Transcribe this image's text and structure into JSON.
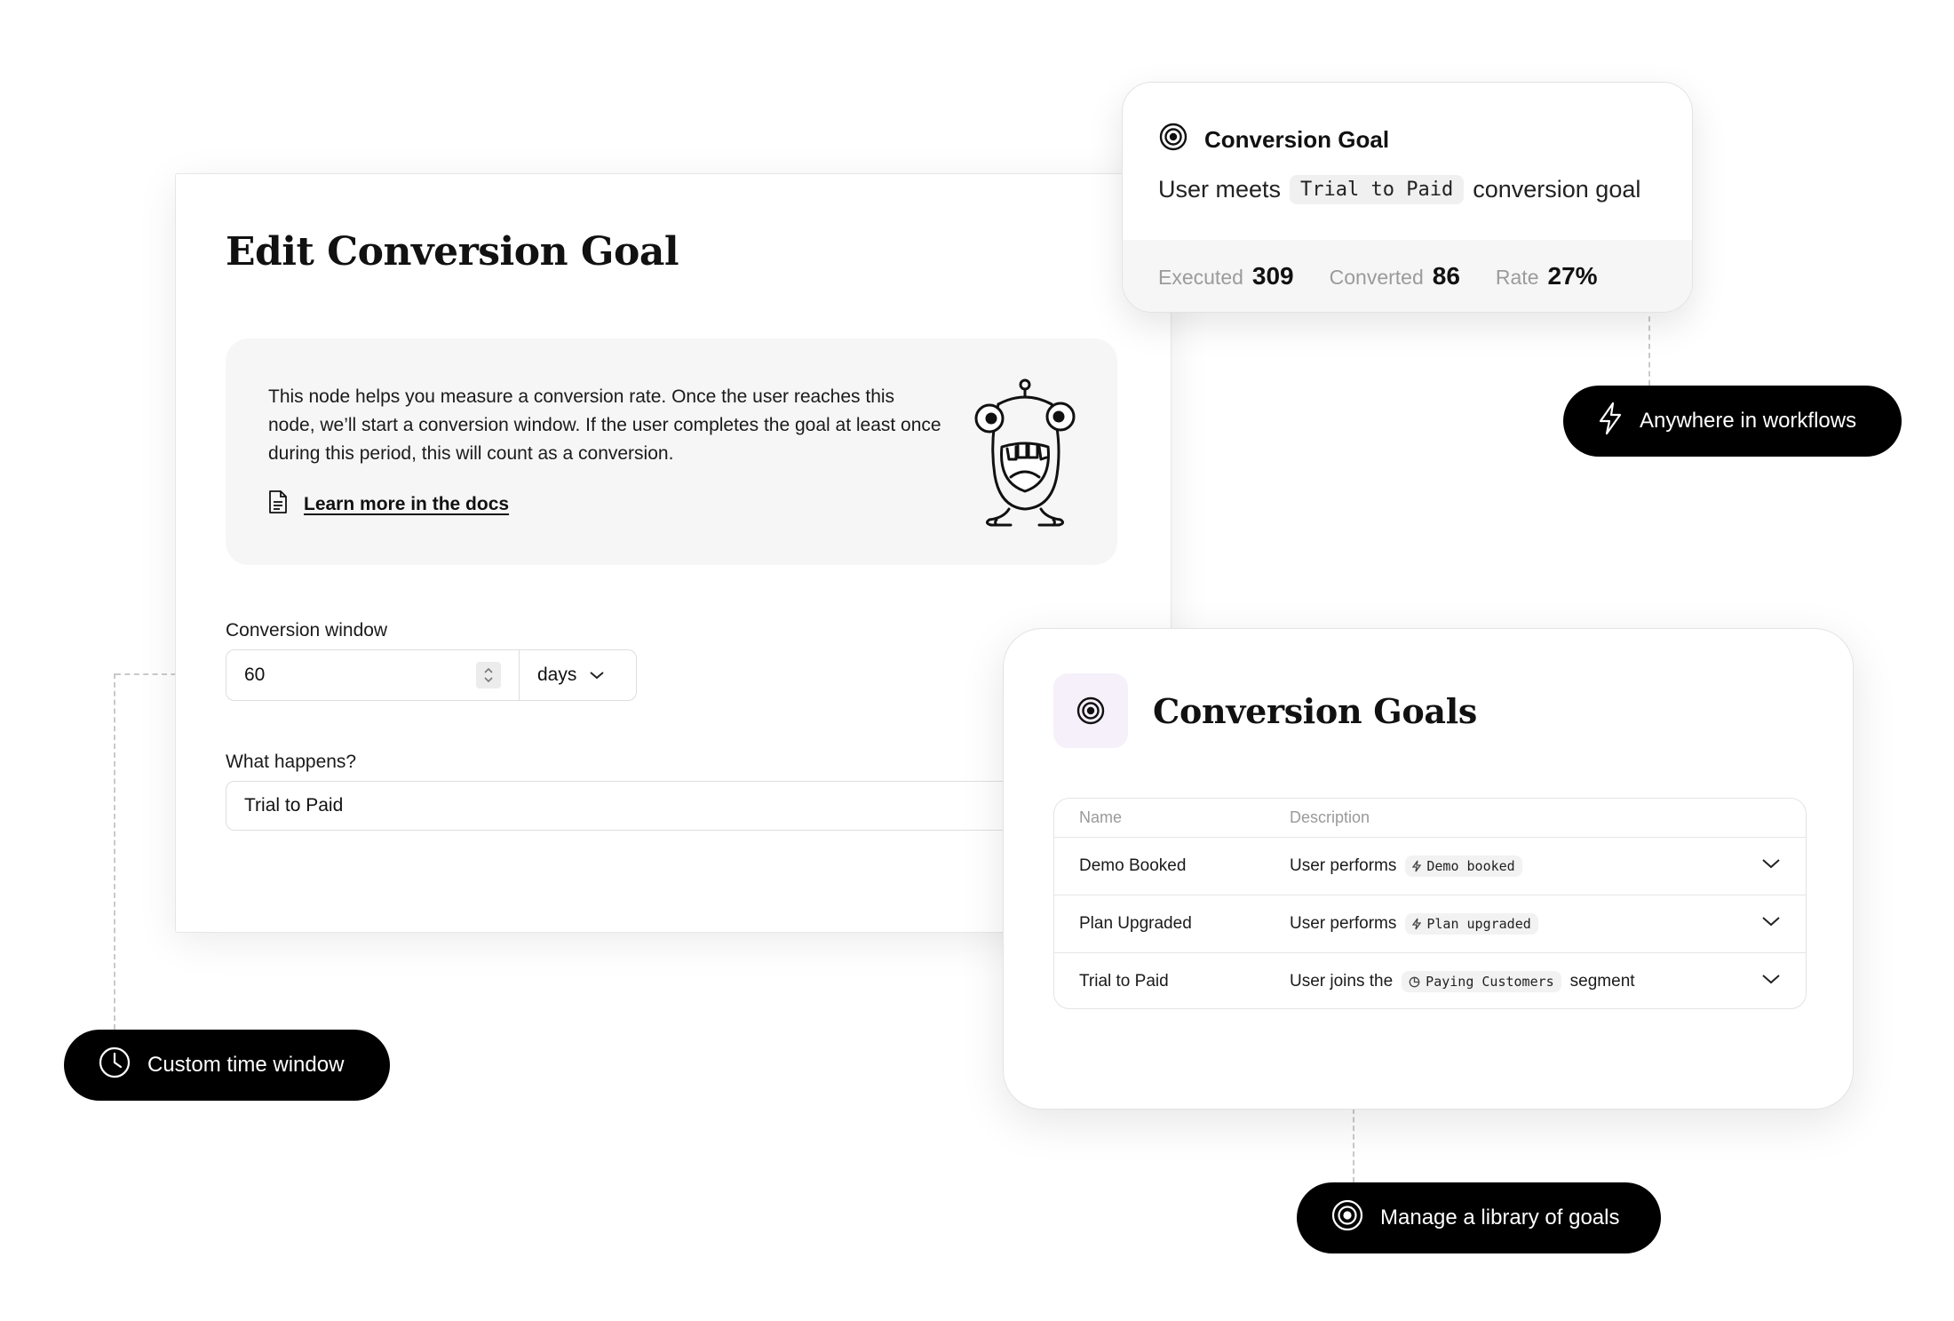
{
  "edit_panel": {
    "title": "Edit Conversion Goal",
    "info_text": "This node helps you measure a conversion rate. Once the user reaches this node, we’ll start a conversion window. If the user completes the goal at least once during this period, this will count as a conversion.",
    "docs_link": "Learn more in the docs",
    "conversion_window_label": "Conversion window",
    "conversion_window_value": "60",
    "conversion_window_unit": "days",
    "what_happens_label": "What happens?",
    "what_happens_value": "Trial to Paid"
  },
  "goal_card": {
    "title": "Conversion Goal",
    "desc_prefix": "User meets",
    "desc_code": "Trial to Paid",
    "desc_suffix": "conversion goal",
    "stats": [
      {
        "label": "Executed",
        "value": "309"
      },
      {
        "label": "Converted",
        "value": "86"
      },
      {
        "label": "Rate",
        "value": "27%"
      }
    ]
  },
  "pills": {
    "workflows": "Anywhere in workflows",
    "time_window": "Custom time window",
    "library": "Manage a library of goals"
  },
  "goals_card": {
    "title": "Conversion Goals",
    "columns": [
      "Name",
      "Description"
    ],
    "rows": [
      {
        "name": "Demo Booked",
        "prefix": "User performs",
        "tag": "Demo booked",
        "tag_icon": "bolt-icon",
        "suffix": ""
      },
      {
        "name": "Plan Upgraded",
        "prefix": "User performs",
        "tag": "Plan upgraded",
        "tag_icon": "bolt-icon",
        "suffix": ""
      },
      {
        "name": "Trial to Paid",
        "prefix": "User joins the",
        "tag": "Paying Customers",
        "tag_icon": "segment-icon",
        "suffix": "segment"
      }
    ]
  },
  "icons": {
    "target": "target-icon",
    "bolt": "bolt-icon",
    "clock": "clock-icon",
    "document": "document-icon",
    "chevron": "chevron-down-icon"
  },
  "colors": {
    "pill_bg": "#000000",
    "info_bg": "#f6f6f6",
    "icon_box_bg": "#f6f0fb",
    "muted_text": "#9b9b9b"
  }
}
